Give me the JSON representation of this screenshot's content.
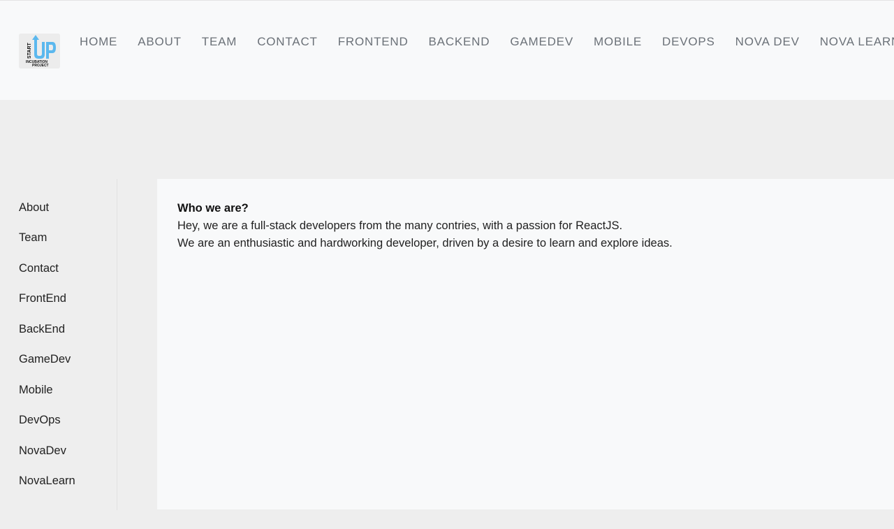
{
  "header": {
    "logo": {
      "text_start": "START",
      "text_up": "UP",
      "text_incubation": "INCUBATION",
      "text_project": "PROJECT",
      "accent_color": "#5bb8ee"
    },
    "nav": [
      {
        "label": "HOME"
      },
      {
        "label": "ABOUT"
      },
      {
        "label": "TEAM"
      },
      {
        "label": "CONTACT"
      },
      {
        "label": "FRONTEND"
      },
      {
        "label": "BACKEND"
      },
      {
        "label": "GAMEDEV"
      },
      {
        "label": "MOBILE"
      },
      {
        "label": "DEVOPS"
      },
      {
        "label": "NOVA DEV"
      },
      {
        "label": "NOVA LEARN"
      }
    ]
  },
  "sidebar": {
    "items": [
      {
        "label": "About"
      },
      {
        "label": "Team"
      },
      {
        "label": "Contact"
      },
      {
        "label": "FrontEnd"
      },
      {
        "label": "BackEnd"
      },
      {
        "label": "GameDev"
      },
      {
        "label": "Mobile"
      },
      {
        "label": "DevOps"
      },
      {
        "label": "NovaDev"
      },
      {
        "label": "NovaLearn"
      }
    ]
  },
  "main": {
    "title": "Who we are?",
    "paragraphs": [
      "Hey, we are a full-stack developers from the many contries, with a passion for ReactJS.",
      "We are an enthusiastic and hardworking developer, driven by a desire to learn and explore ideas."
    ]
  }
}
